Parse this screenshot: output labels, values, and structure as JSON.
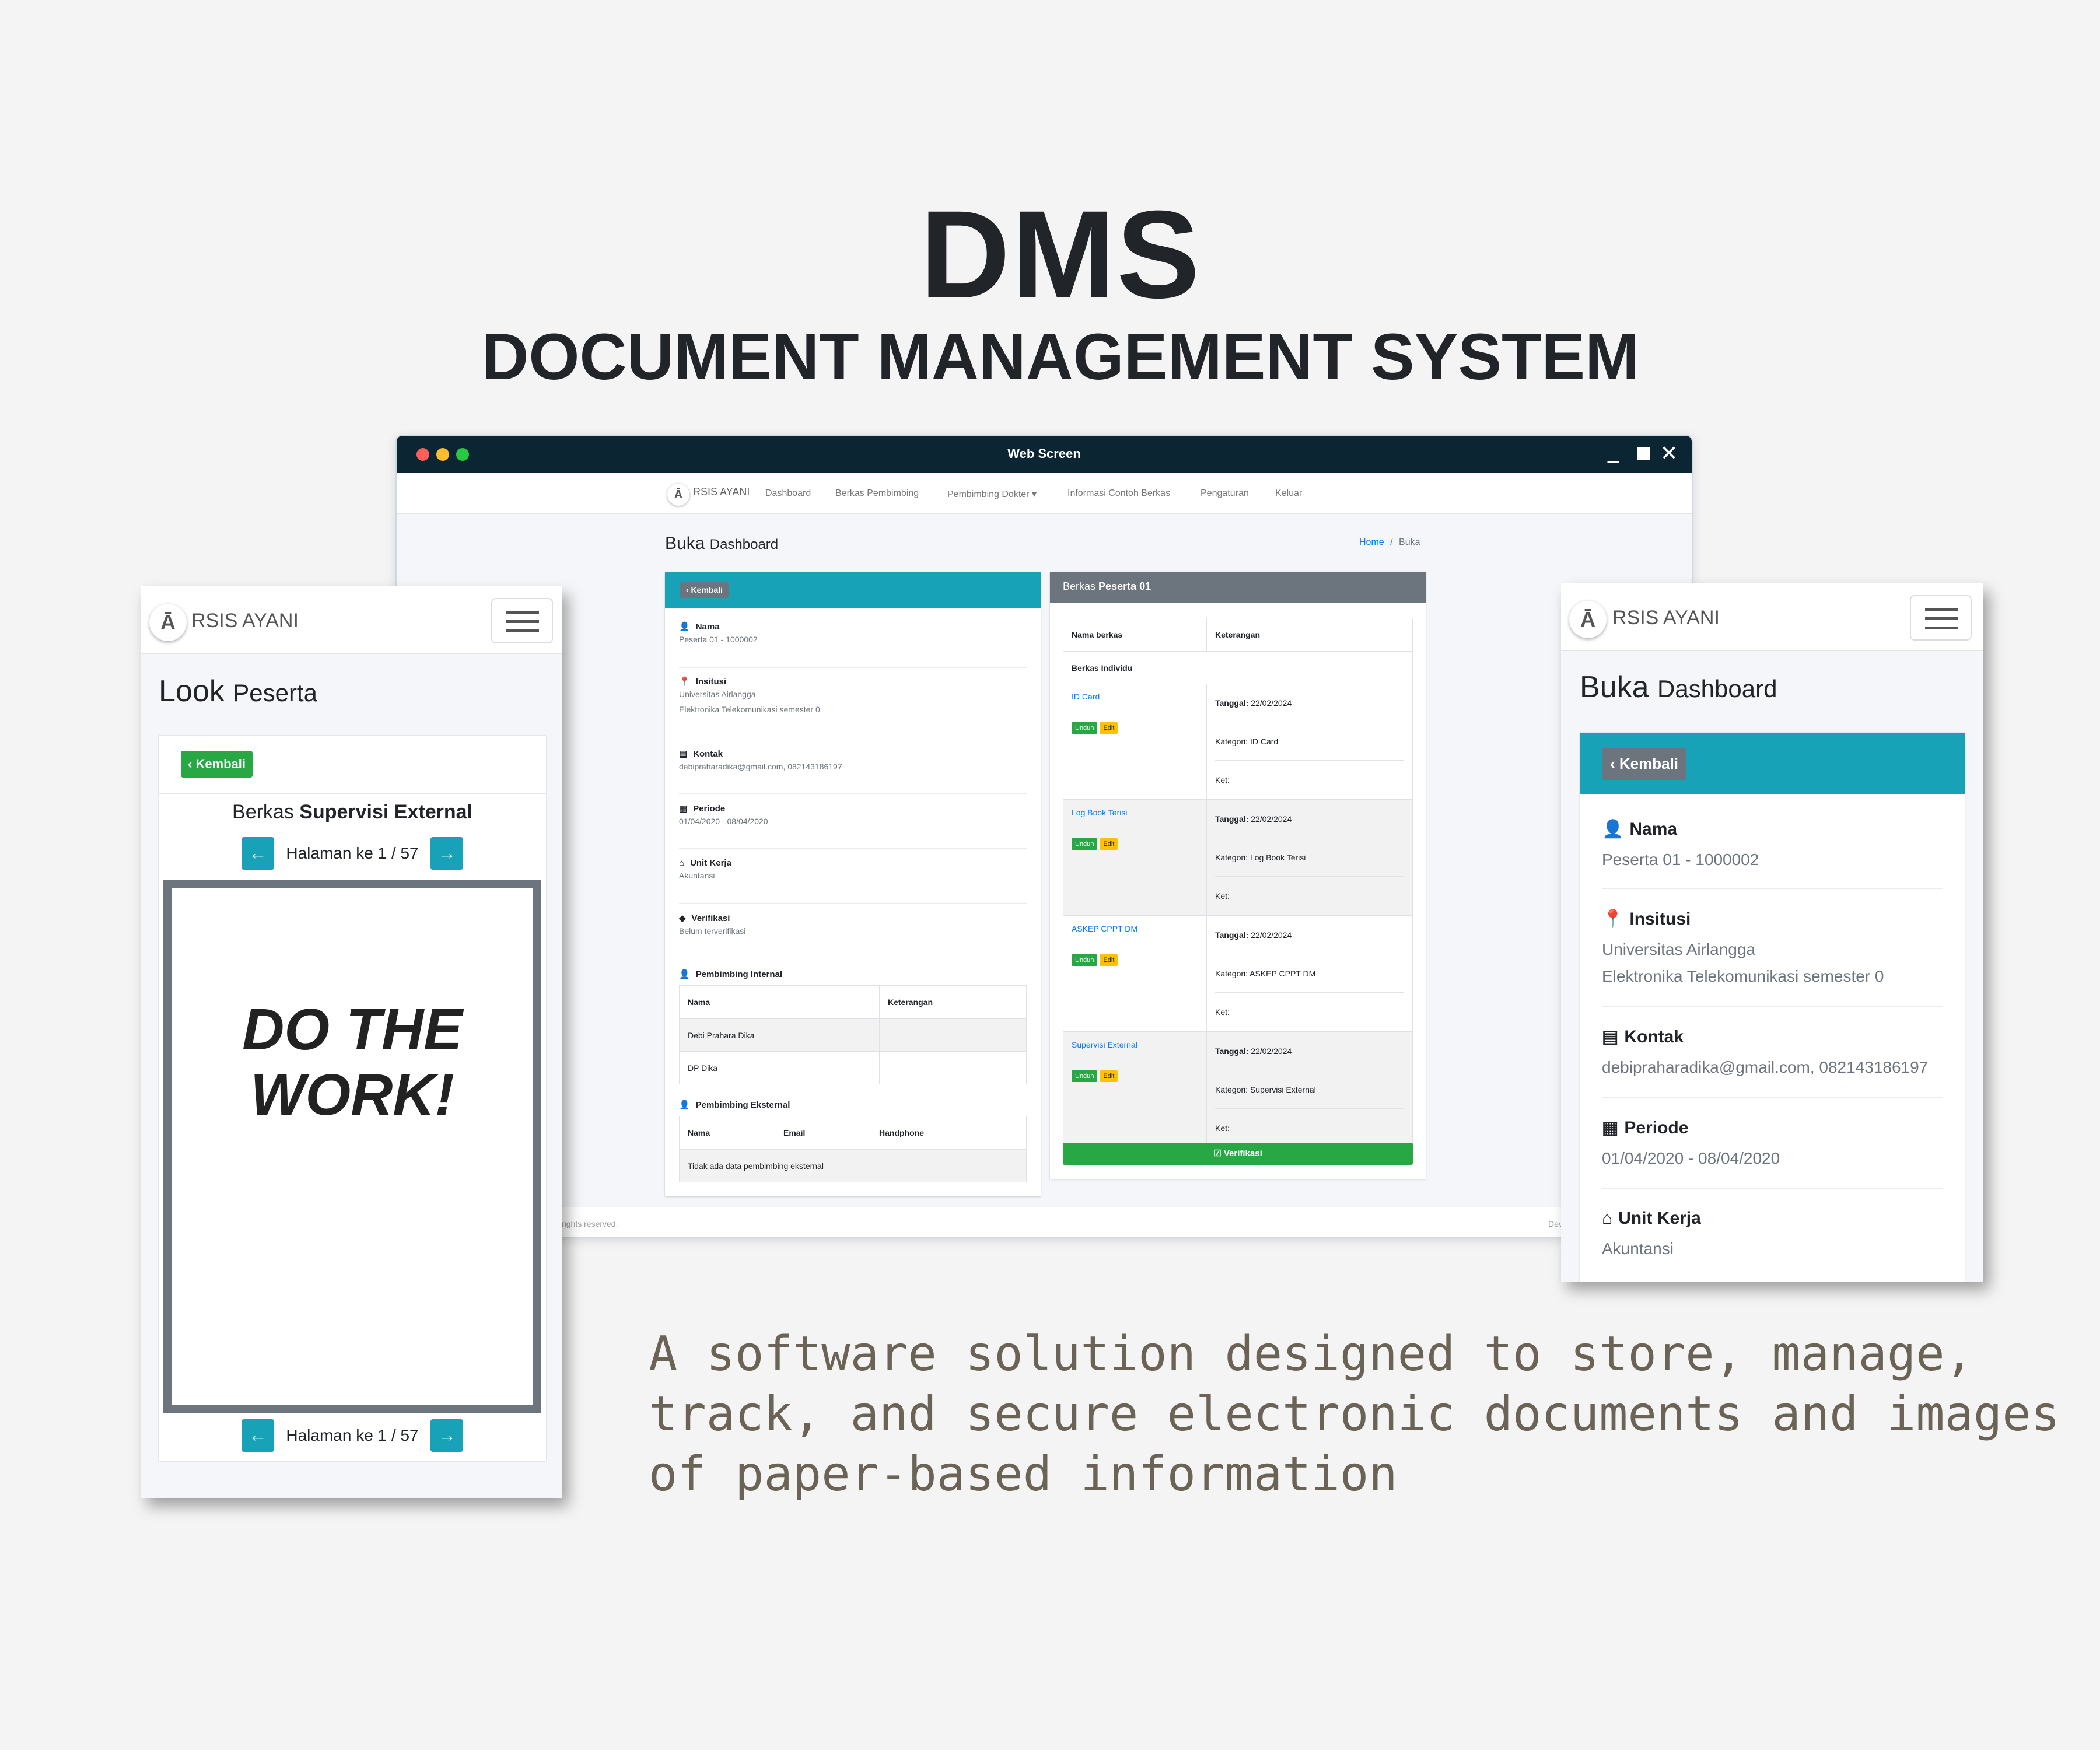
{
  "hero": {
    "title": "DMS",
    "subtitle": "DOCUMENT MANAGEMENT SYSTEM",
    "tagline": "A software solution designed to store, manage, track, and secure electronic documents and images of paper-based information"
  },
  "colors": {
    "titlebar": "#0b2533",
    "info": "#17a2b8",
    "success": "#28a745",
    "warning": "#ffc107",
    "secondary": "#6c757d",
    "primary": "#007bff"
  },
  "desktop": {
    "window_title": "Web Screen",
    "nav": {
      "brand": "RSIS AYANI",
      "items": [
        "Dashboard",
        "Berkas Pembimbing",
        "Pembimbing Dokter ▾",
        "Informasi Contoh Berkas",
        "Pengaturan",
        "Keluar"
      ]
    },
    "page_title": "Buka",
    "page_title_small": "Dashboard",
    "breadcrumb": {
      "home": "Home",
      "sep": "/",
      "current": "Buka"
    },
    "profile": {
      "back_label": "‹ Kembali",
      "fields": [
        {
          "icon": "user-icon",
          "glyph": "👤",
          "label": "Nama",
          "value": "Peserta 01 - 1000002"
        },
        {
          "icon": "map-marker-icon",
          "glyph": "📍",
          "label": "Insitusi",
          "value": "Universitas Airlangga",
          "value2": "Elektronika Telekomunikasi semester 0"
        },
        {
          "icon": "address-card-icon",
          "glyph": "▤",
          "label": "Kontak",
          "value": "debipraharadika@gmail.com, 082143186197"
        },
        {
          "icon": "calendar-icon",
          "glyph": "▦",
          "label": "Periode",
          "value": "01/04/2020 - 08/04/2020"
        },
        {
          "icon": "home-icon",
          "glyph": "⌂",
          "label": "Unit Kerja",
          "value": "Akuntansi"
        },
        {
          "icon": "tag-icon",
          "glyph": "◆",
          "label": "Verifikasi",
          "value": "Belum terverifikasi"
        }
      ],
      "internal_label": "Pembimbing Internal",
      "internal_headers": [
        "Nama",
        "Keterangan"
      ],
      "internal_rows": [
        "Debi Prahara Dika",
        "DP Dika"
      ],
      "external_label": "Pembimbing Eksternal",
      "external_headers": [
        "Nama",
        "Email",
        "Handphone"
      ],
      "external_empty": "Tidak ada data pembimbing eksternal"
    },
    "berkas": {
      "header_prefix": "Berkas",
      "header_name": "Peserta 01",
      "col_name": "Nama berkas",
      "col_ket": "Keterangan",
      "group": "Berkas Individu",
      "download_label": "Unduh",
      "edit_label": "Edit",
      "tanggal_label": "Tanggal:",
      "kategori_label": "Kategori:",
      "ket_label": "Ket:",
      "files": [
        {
          "name": "ID Card",
          "date": "22/02/2024",
          "kategori": "ID Card"
        },
        {
          "name": "Log Book Terisi",
          "date": "22/02/2024",
          "kategori": "Log Book Terisi"
        },
        {
          "name": "ASKEP CPPT DM",
          "date": "22/02/2024",
          "kategori": "ASKEP CPPT DM"
        },
        {
          "name": "Supervisi External",
          "date": "22/02/2024",
          "kategori": "Supervisi External"
        }
      ],
      "verify_label": "☑ Verifikasi"
    },
    "footer_left": "rights reserved.",
    "footer_right": "Dev"
  },
  "mobile_left": {
    "brand": "RSIS AYANI",
    "title": "Look",
    "title_small": "Peserta",
    "back_label": "‹ Kembali",
    "doc_title_prefix": "Berkas",
    "doc_title_name": "Supervisi External",
    "page_text": "Halaman ke 1 / 57",
    "poster_line1": "DO THE",
    "poster_line2": "WORK!"
  },
  "mobile_right": {
    "brand": "RSIS AYANI",
    "title": "Buka",
    "title_small": "Dashboard",
    "back_label": "‹ Kembali",
    "fields": [
      {
        "icon": "user-icon",
        "glyph": "👤",
        "label": "Nama",
        "value": "Peserta 01 - 1000002"
      },
      {
        "icon": "map-marker-icon",
        "glyph": "📍",
        "label": "Insitusi",
        "value": "Universitas Airlangga",
        "value2": "Elektronika Telekomunikasi semester 0"
      },
      {
        "icon": "address-card-icon",
        "glyph": "▤",
        "label": "Kontak",
        "value": "debipraharadika@gmail.com, 082143186197"
      },
      {
        "icon": "calendar-icon",
        "glyph": "▦",
        "label": "Periode",
        "value": "01/04/2020 - 08/04/2020"
      },
      {
        "icon": "home-icon",
        "glyph": "⌂",
        "label": "Unit Kerja",
        "value": "Akuntansi"
      }
    ]
  }
}
